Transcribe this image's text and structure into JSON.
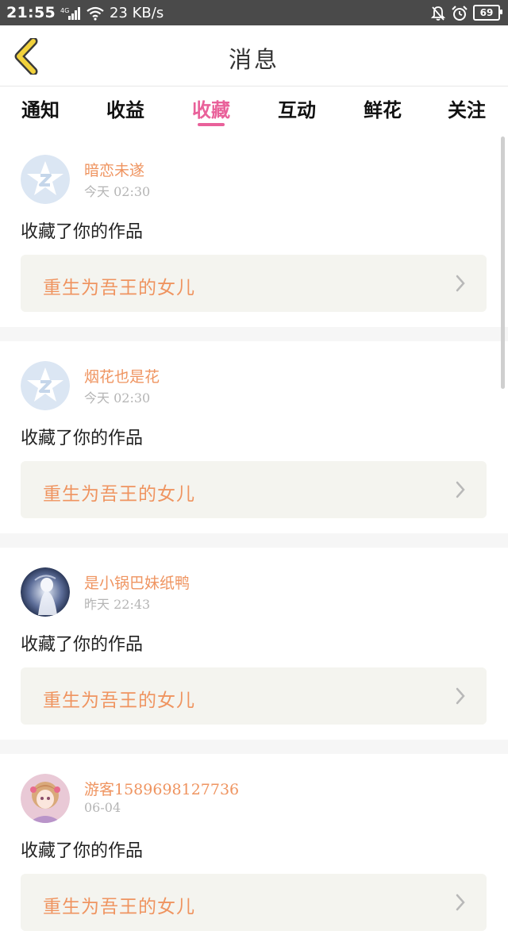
{
  "status_bar": {
    "time": "21:55",
    "network": "4G",
    "speed": "23 KB/s",
    "battery": "69"
  },
  "header": {
    "title": "消息"
  },
  "tabs": [
    {
      "label": "通知"
    },
    {
      "label": "收益"
    },
    {
      "label": "收藏",
      "active": true
    },
    {
      "label": "互动"
    },
    {
      "label": "鲜花"
    },
    {
      "label": "关注"
    }
  ],
  "messages": [
    {
      "user": "暗恋未遂",
      "time": "今天 02:30",
      "action": "收藏了你的作品",
      "work": "重生为吾王的女儿",
      "avatar": "default-star-avatar"
    },
    {
      "user": "烟花也是花",
      "time": "今天 02:30",
      "action": "收藏了你的作品",
      "work": "重生为吾王的女儿",
      "avatar": "default-star-avatar"
    },
    {
      "user": "是小锅巴妹纸鸭",
      "time": "昨天 22:43",
      "action": "收藏了你的作品",
      "work": "重生为吾王的女儿",
      "avatar": "anime-ghost-avatar"
    },
    {
      "user": "游客1589698127736",
      "time": "06-04",
      "action": "收藏了你的作品",
      "work": "重生为吾王的女儿",
      "avatar": "anime-girl-avatar"
    }
  ],
  "colors": {
    "accent_pink": "#e9619a",
    "name_orange": "#ef9460",
    "back_yellow": "#f2d23c"
  }
}
